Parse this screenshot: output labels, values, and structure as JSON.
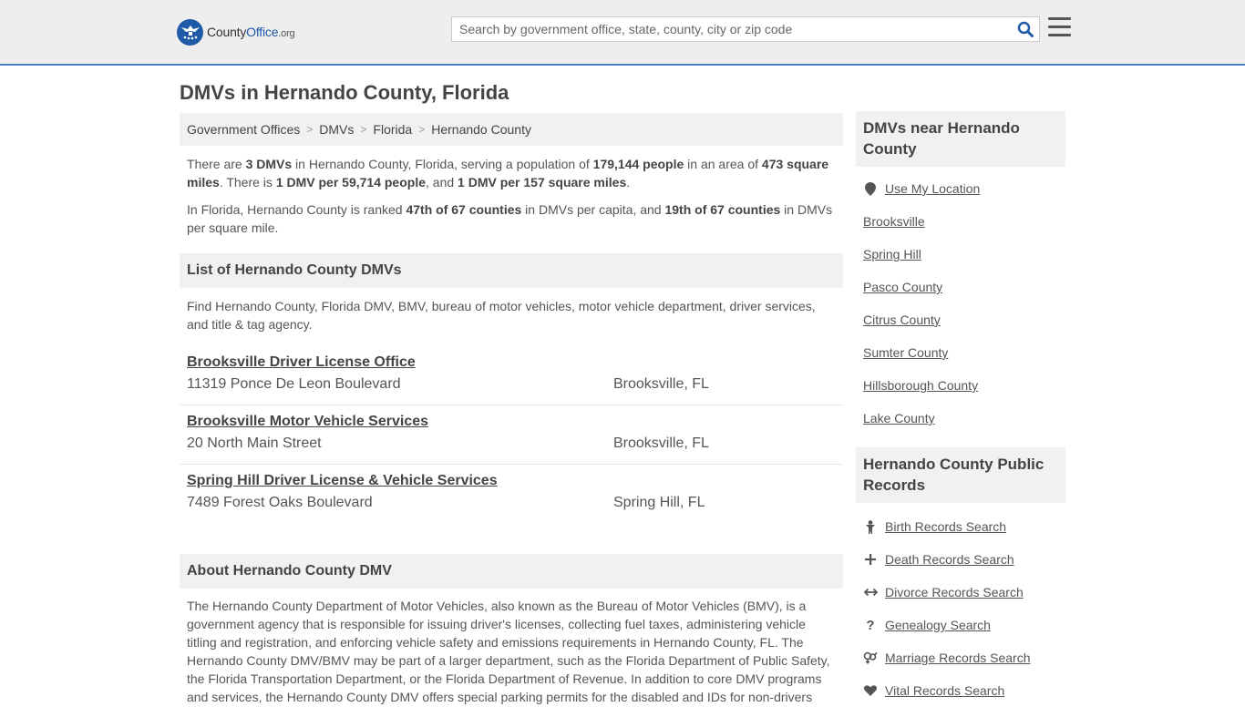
{
  "header": {
    "logo_prefix": "County",
    "logo_brand": "Office",
    "logo_suffix": ".org",
    "search_placeholder": "Search by government office, state, county, city or zip code"
  },
  "page_title": "DMVs in Hernando County, Florida",
  "breadcrumb": [
    "Government Offices",
    "DMVs",
    "Florida",
    "Hernando County"
  ],
  "intro": {
    "p1": {
      "t1": "There are ",
      "b1": "3 DMVs",
      "t2": " in Hernando County, Florida, serving a population of ",
      "b2": "179,144 people",
      "t3": " in an area of ",
      "b3": "473 square miles",
      "t4": ". There is ",
      "b4": "1 DMV per 59,714 people",
      "t5": ", and ",
      "b5": "1 DMV per 157 square miles",
      "t6": "."
    },
    "p2": {
      "t1": "In Florida, Hernando County is ranked ",
      "b1": "47th of 67 counties",
      "t2": " in DMVs per capita, and ",
      "b2": "19th of 67 counties",
      "t3": " in DMVs per square mile."
    }
  },
  "list_section": {
    "title": "List of Hernando County DMVs",
    "description": "Find Hernando County, Florida DMV, BMV, bureau of motor vehicles, motor vehicle department, driver services, and title & tag agency.",
    "offices": [
      {
        "name": "Brooksville Driver License Office",
        "address": "11319 Ponce De Leon Boulevard",
        "city": "Brooksville, FL"
      },
      {
        "name": "Brooksville Motor Vehicle Services",
        "address": "20 North Main Street",
        "city": "Brooksville, FL"
      },
      {
        "name": "Spring Hill Driver License & Vehicle Services",
        "address": "7489 Forest Oaks Boulevard",
        "city": "Spring Hill, FL"
      }
    ]
  },
  "about_section": {
    "title": "About Hernando County DMV",
    "text": "The Hernando County Department of Motor Vehicles, also known as the Bureau of Motor Vehicles (BMV), is a government agency that is responsible for issuing driver's licenses, collecting fuel taxes, administering vehicle titling and registration, and enforcing vehicle safety and emissions requirements in Hernando County, FL. The Hernando County DMV/BMV may be part of a larger department, such as the Florida Department of Public Safety, the Florida Transportation Department, or the Florida Department of Revenue. In addition to core DMV programs and services, the Hernando County DMV offers special parking permits for the disabled and IDs for non-drivers"
  },
  "sidebar": {
    "nearby": {
      "title": "DMVs near Hernando County",
      "use_location": "Use My Location",
      "links": [
        "Brooksville",
        "Spring Hill",
        "Pasco County",
        "Citrus County",
        "Sumter County",
        "Hillsborough County",
        "Lake County"
      ]
    },
    "records": {
      "title": "Hernando County Public Records",
      "links": [
        {
          "label": "Birth Records Search",
          "icon": "baby-icon"
        },
        {
          "label": "Death Records Search",
          "icon": "cross-icon"
        },
        {
          "label": "Divorce Records Search",
          "icon": "split-arrows-icon"
        },
        {
          "label": "Genealogy Search",
          "icon": "question-icon"
        },
        {
          "label": "Marriage Records Search",
          "icon": "gender-symbols-icon"
        },
        {
          "label": "Vital Records Search",
          "icon": "heart-icon"
        }
      ]
    }
  }
}
